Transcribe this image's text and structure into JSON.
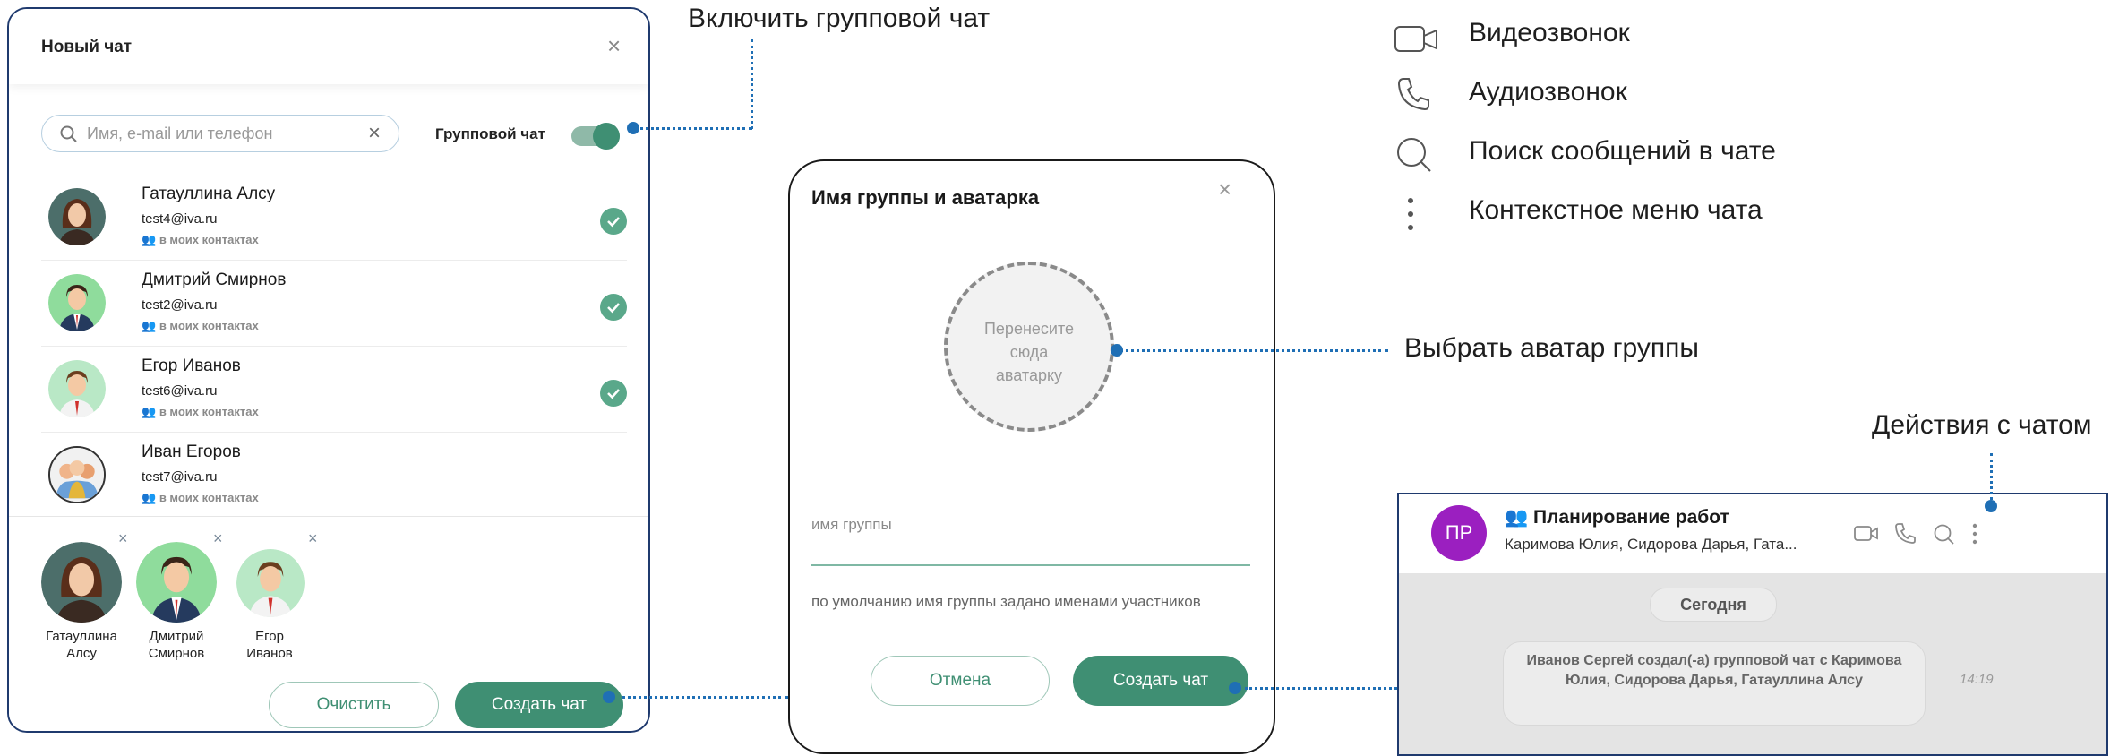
{
  "new_chat": {
    "title": "Новый чат",
    "search_placeholder": "Имя, e-mail или телефон",
    "group_chat_label": "Групповой чат",
    "contacts": [
      {
        "name": "Гатауллина Алсу",
        "email": "test4@iva.ru",
        "tag": "в моих контактах",
        "selected": true
      },
      {
        "name": "Дмитрий Смирнов",
        "email": "test2@iva.ru",
        "tag": "в моих контактах",
        "selected": true
      },
      {
        "name": "Егор Иванов",
        "email": "test6@iva.ru",
        "tag": "в моих контактах",
        "selected": true
      },
      {
        "name": "Иван Егоров",
        "email": "test7@iva.ru",
        "tag": "в моих контактах",
        "selected": false
      }
    ],
    "selected": [
      {
        "line1": "Гатауллина",
        "line2": "Алсу"
      },
      {
        "line1": "Дмитрий",
        "line2": "Смирнов"
      },
      {
        "line1": "Егор",
        "line2": "Иванов"
      }
    ],
    "clear_label": "Очистить",
    "create_label": "Создать чат"
  },
  "group_dialog": {
    "title": "Имя группы и аватарка",
    "drop_line1": "Перенесите",
    "drop_line2": "сюда",
    "drop_line3": "аватарку",
    "name_placeholder": "имя группы",
    "hint": "по умолчанию имя группы задано именами участников",
    "cancel_label": "Отмена",
    "create_label": "Создать чат"
  },
  "chat_header": {
    "initials": "ПР",
    "title": "Планирование работ",
    "members": "Каримова Юлия, Сидорова Дарья, Гата...",
    "date_badge": "Сегодня",
    "system_message": "Иванов Сергей создал(-а) групповой чат с Каримова Юлия, Сидорова Дарья, Гатауллина Алсу",
    "time": "14:19"
  },
  "callouts": {
    "enable_group": "Включить групповой чат",
    "choose_avatar": "Выбрать аватар группы",
    "chat_actions": "Действия с чатом"
  },
  "legend": [
    {
      "icon": "video-icon",
      "label": "Видеозвонок"
    },
    {
      "icon": "phone-icon",
      "label": "Аудиозвонок"
    },
    {
      "icon": "search-icon",
      "label": "Поиск сообщений в чате"
    },
    {
      "icon": "more-vertical-icon",
      "label": "Контекстное меню чата"
    }
  ],
  "colors": {
    "accent": "#3f8f73",
    "avatar_purple": "#9b1fc0",
    "callout_blue": "#1f6fb5",
    "frame_navy": "#1f3a6e"
  }
}
